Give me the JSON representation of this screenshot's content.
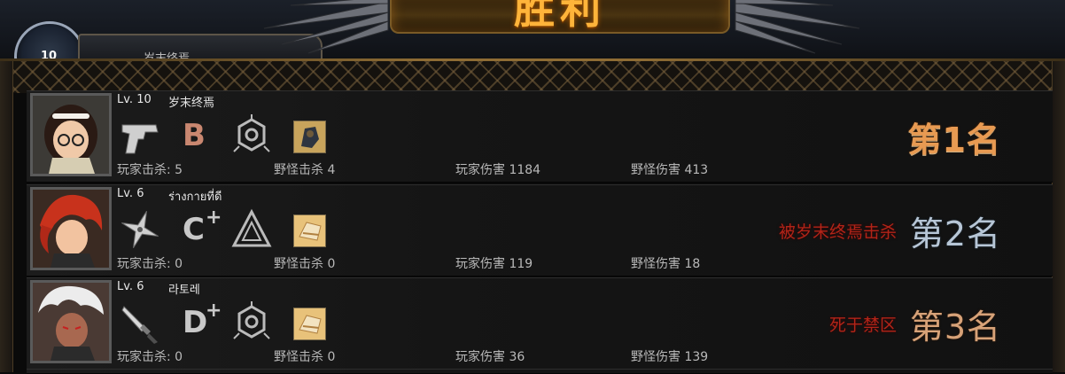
{
  "header": {
    "victory_label": "胜利",
    "player_level": "10",
    "player_name": "岁末终焉"
  },
  "players": [
    {
      "level": "Lv. 10",
      "name": "岁末终焉",
      "weapon": "pistol-icon",
      "grade": "B",
      "grade_plus": "",
      "spec": "hexagon-emblem-icon",
      "item": "armored-item-icon",
      "stats": {
        "player_kills": "玩家击杀: 5",
        "monster_kills": "野怪击杀 4",
        "player_damage": "玩家伤害 1184",
        "monster_damage": "野怪伤害 413"
      },
      "death_note": "",
      "rank": "第1名",
      "colors": {
        "grade": "#c98770",
        "hair": "#2a1a14",
        "skin": "#f0c9a8"
      }
    },
    {
      "level": "Lv. 6",
      "name": "ร่างกายที่ดี",
      "weapon": "shuriken-icon",
      "grade": "C",
      "grade_plus": "+",
      "spec": "triangle-emblem-icon",
      "item": "bread-item-icon",
      "stats": {
        "player_kills": "玩家击杀: 0",
        "monster_kills": "野怪击杀 0",
        "player_damage": "玩家伤害 119",
        "monster_damage": "野怪伤害 18"
      },
      "death_note": "被岁末终焉击杀",
      "rank": "第2名",
      "colors": {
        "grade": "#c8c8c8",
        "hair": "#c8321c",
        "skin": "#f2c3a0"
      }
    },
    {
      "level": "Lv. 6",
      "name": "라토레",
      "weapon": "dagger-icon",
      "grade": "D",
      "grade_plus": "+",
      "spec": "hexagon-emblem-icon",
      "item": "bread-item-icon",
      "stats": {
        "player_kills": "玩家击杀: 0",
        "monster_kills": "野怪击杀 0",
        "player_damage": "玩家伤害 36",
        "monster_damage": "野怪伤害 139"
      },
      "death_note": "死于禁区",
      "rank": "第3名",
      "colors": {
        "grade": "#c8c8c8",
        "hair": "#e8e8e8",
        "skin": "#a86850"
      }
    }
  ]
}
